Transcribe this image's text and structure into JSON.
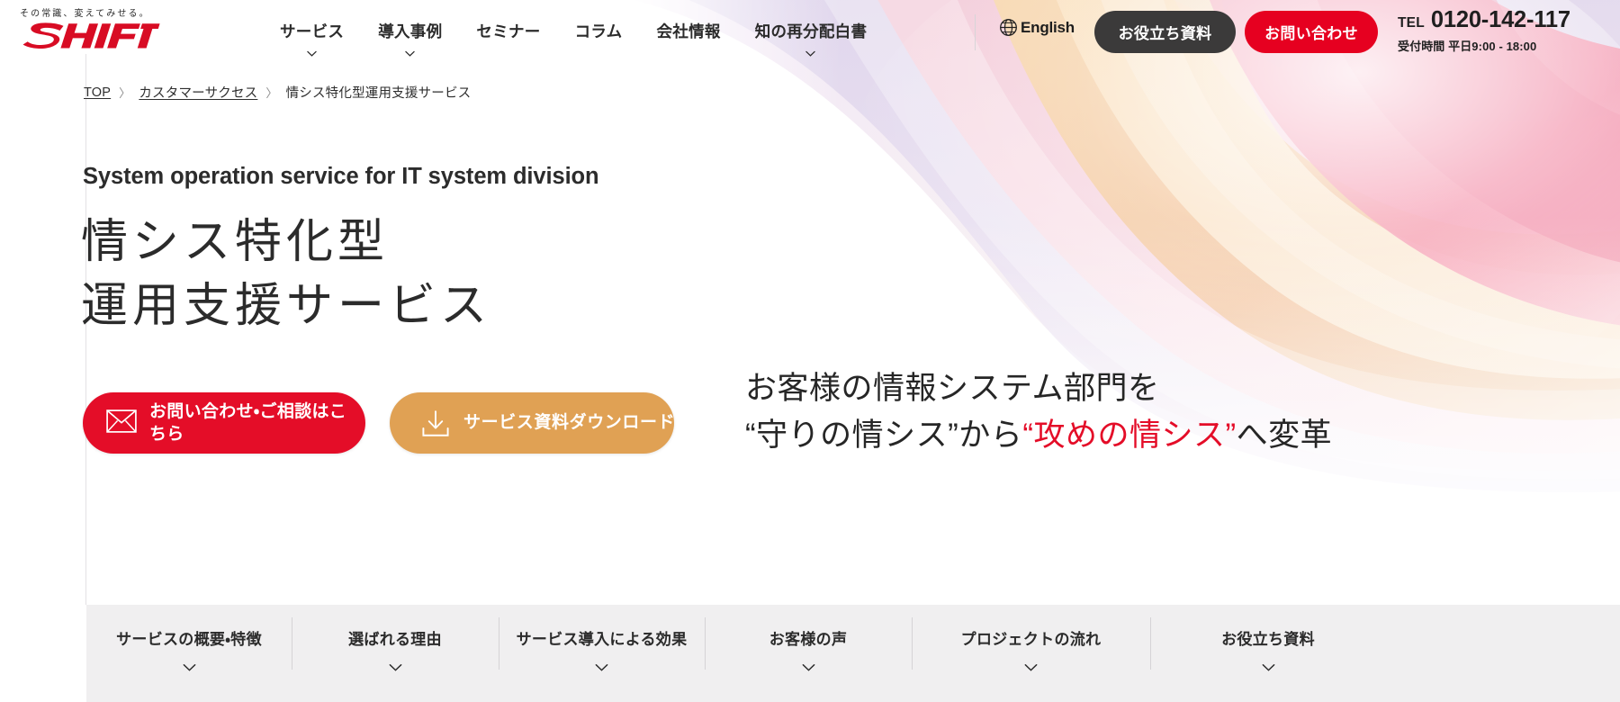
{
  "brand": {
    "tagline": "その常識、変えてみせる。",
    "name": "SHIFT",
    "logo_color": "#d80c24",
    "accent_red": "#e40d28",
    "accent_orange": "#e0a154",
    "dark": "#3b3a3a"
  },
  "header": {
    "nav": [
      {
        "label": "サービス",
        "has_dropdown": true
      },
      {
        "label": "導入事例",
        "has_dropdown": true
      },
      {
        "label": "セミナー",
        "has_dropdown": false
      },
      {
        "label": "コラム",
        "has_dropdown": false
      },
      {
        "label": "会社情報",
        "has_dropdown": false
      },
      {
        "label": "知の再分配白書",
        "has_dropdown": true
      }
    ],
    "language": {
      "label": "English",
      "icon": "globe-icon"
    },
    "buttons": {
      "docs": "お役立ち資料",
      "contact": "お問い合わせ"
    },
    "tel": {
      "label": "TEL",
      "number": "0120-142-117",
      "hours": "受付時間 平日9:00 - 18:00"
    }
  },
  "breadcrumb": {
    "items": [
      {
        "label": "TOP",
        "link": true
      },
      {
        "label": "カスタマーサクセス",
        "link": true
      },
      {
        "label": "情シス特化型運用支援サービス",
        "link": false
      }
    ],
    "separator": "＞"
  },
  "hero": {
    "eyebrow_en": "System operation service for IT system division",
    "title_line1": "情シス特化型",
    "title_line2": "運用支援サービス",
    "cta": [
      {
        "label": "お問い合わせ・ご相談はこちら",
        "icon": "envelope-icon",
        "style": "primary"
      },
      {
        "label": "サービス資料ダウンロード",
        "icon": "download-icon",
        "style": "secondary"
      }
    ],
    "tagline": {
      "line1": "お客様の情報システム部門を",
      "line2_part1": "“守りの情シス”から",
      "line2_accent": "“攻めの情シス”",
      "line2_part2": "へ変革"
    }
  },
  "anchor_nav": {
    "items": [
      {
        "label": "サービスの概要・特徴"
      },
      {
        "label": "選ばれる理由"
      },
      {
        "label": "サービス導入による効果"
      },
      {
        "label": "お客様の声"
      },
      {
        "label": "プロジェクトの流れ"
      },
      {
        "label": "お役立ち資料"
      }
    ]
  }
}
